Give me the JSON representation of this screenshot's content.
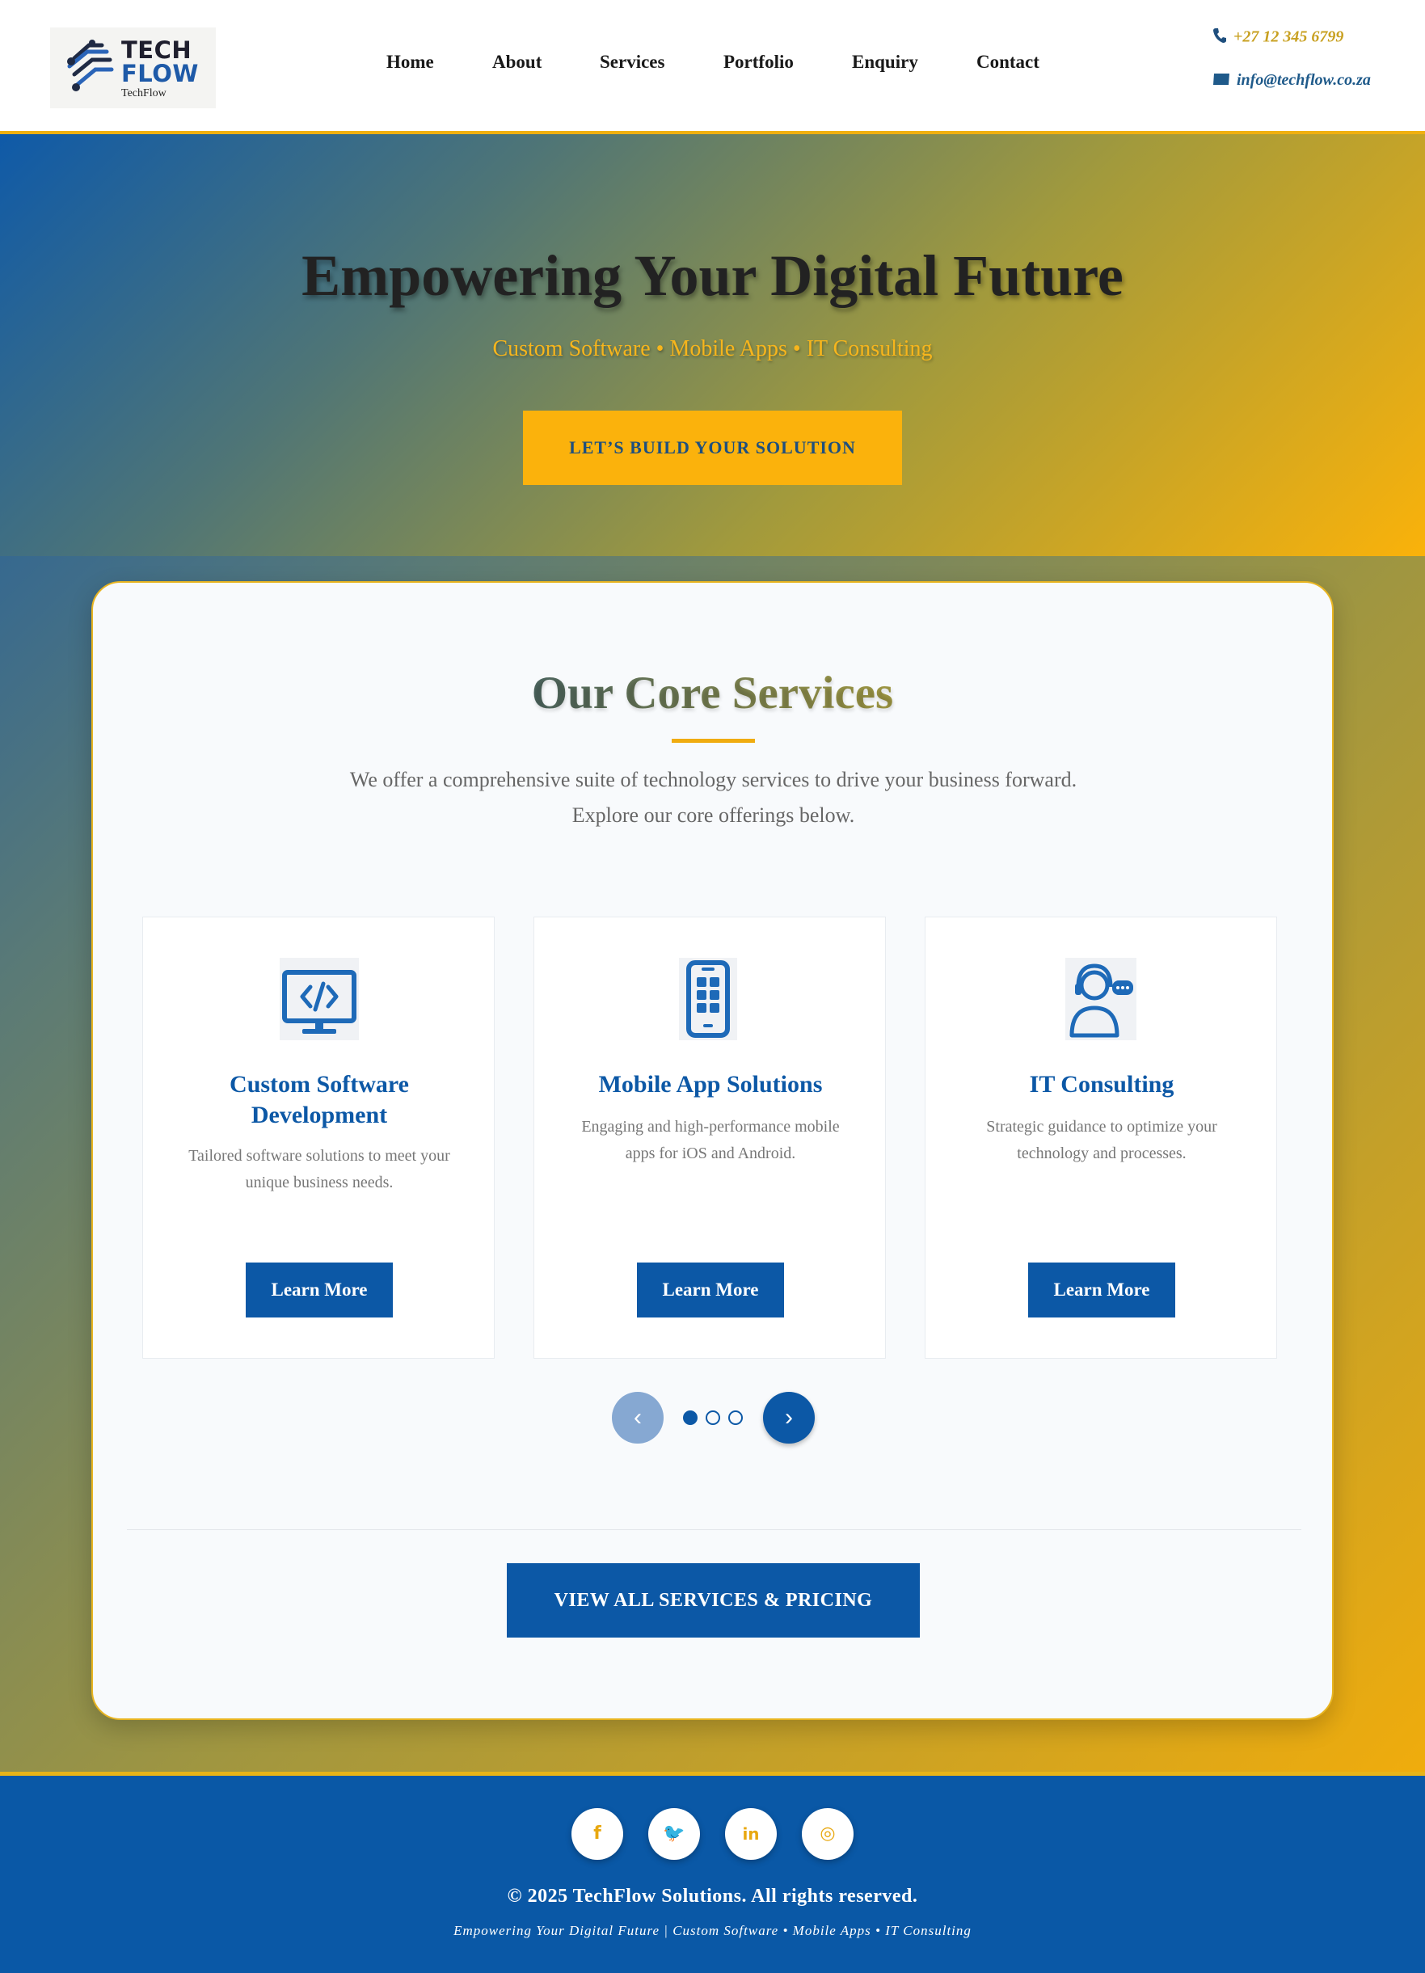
{
  "brand": {
    "line1": "TECH",
    "line2": "FLOW",
    "subtitle": "TechFlow"
  },
  "nav": [
    "Home",
    "About",
    "Services",
    "Portfolio",
    "Enquiry",
    "Contact"
  ],
  "contact": {
    "phone": "+27 12 345 6799",
    "email": "info@techflow.co.za"
  },
  "hero": {
    "title": "Empowering Your Digital Future",
    "subtitle": "Custom Software • Mobile Apps • IT Consulting",
    "cta": "LET’S BUILD YOUR SOLUTION"
  },
  "services": {
    "title": "Our Core Services",
    "description_line1": "We offer a comprehensive suite of technology services to drive your business forward.",
    "description_line2": "Explore our core offerings below.",
    "items": [
      {
        "title_line1": "Custom Software",
        "title_line2": "Development",
        "desc_line1": "Tailored software solutions to meet your",
        "desc_line2": "unique business needs.",
        "button": "Learn More",
        "icon": "code-monitor-icon"
      },
      {
        "title_line1": "Mobile App Solutions",
        "desc_line1": "Engaging and high-performance mobile",
        "desc_line2": "apps for iOS and Android.",
        "button": "Learn More",
        "icon": "mobile-phone-icon"
      },
      {
        "title_line1": "IT Consulting",
        "desc_line1": "Strategic guidance to optimize your",
        "desc_line2": "technology and processes.",
        "button": "Learn More",
        "icon": "consultant-headset-icon"
      }
    ],
    "carousel": {
      "prev": "‹",
      "next": "›",
      "active_page": 1,
      "total_pages": 3
    },
    "view_all": "VIEW ALL SERVICES & PRICING"
  },
  "footer": {
    "social": [
      {
        "icon": "facebook-icon",
        "glyph": "f"
      },
      {
        "icon": "twitter-icon",
        "glyph": "🐦"
      },
      {
        "icon": "linkedin-icon",
        "glyph": "in"
      },
      {
        "icon": "instagram-icon",
        "glyph": "◎"
      }
    ],
    "copyright": "© 2025 TechFlow Solutions. All rights reserved.",
    "tagline": "Empowering Your Digital Future | Custom Software • Mobile Apps • IT Consulting"
  },
  "colors": {
    "primary": "#0c58a6",
    "accent": "#fbb20c",
    "text_dark": "#222222"
  }
}
